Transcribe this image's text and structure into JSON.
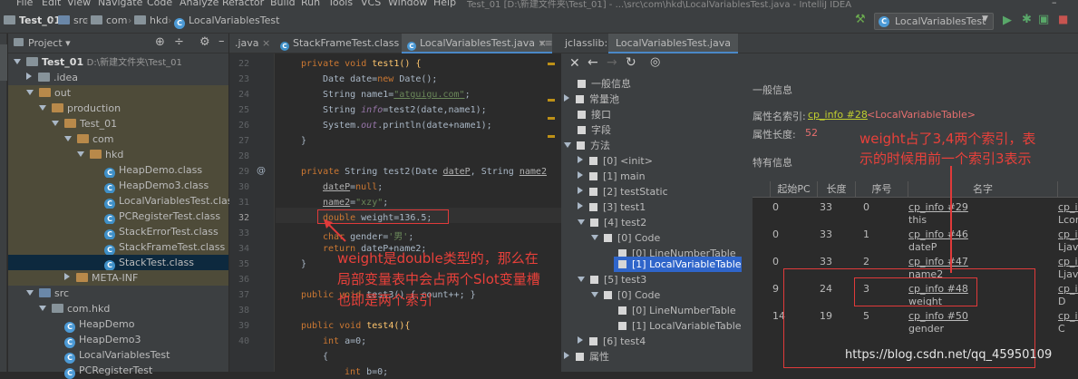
{
  "menu": [
    "File",
    "Edit",
    "View",
    "Navigate",
    "Code",
    "Analyze",
    "Refactor",
    "Build",
    "Run",
    "Tools",
    "VCS",
    "Window",
    "Help"
  ],
  "window_title": "Test_01 [D:\\新建文件夹\\Test_01] - ...\\src\\com\\hkd\\LocalVariablesTest.java - IntelliJ IDEA",
  "breadcrumb": [
    "Test_01",
    "src",
    "com",
    "hkd",
    "LocalVariablesTest"
  ],
  "run_config": "LocalVariablesTest",
  "project": {
    "title": "Project",
    "root_label": "Test_01",
    "root_path": "D:\\新建文件夹\\Test_01",
    "items": [
      ".idea",
      "out",
      "production",
      "Test_01",
      "com",
      "hkd",
      "HeapDemo.class",
      "HeapDemo3.class",
      "LocalVariablesTest.class",
      "PCRegisterTest.class",
      "StackErrorTest.class",
      "StackFrameTest.class",
      "StackTest.class",
      "META-INF",
      "src",
      "com.hkd",
      "HeapDemo",
      "HeapDemo3",
      "LocalVariablesTest",
      "PCRegisterTest"
    ]
  },
  "editor_tabs": [
    ".java",
    "StackFrameTest.class",
    "LocalVariablesTest.java"
  ],
  "line_numbers": [
    "22",
    "23",
    "24",
    "25",
    "26",
    "27",
    "28",
    "29",
    "30",
    "31",
    "32",
    "33",
    "34",
    "35",
    "36",
    "37",
    "38",
    "39",
    "40"
  ],
  "code": {
    "l22a": "private void ",
    "l22b": "test1() {",
    "l23a": "Date date=",
    "l23b": "new ",
    "l23c": "Date();",
    "l24a": "String name1=",
    "l24b": "\"atguigu.com\"",
    "l24c": ";",
    "l25a": "String ",
    "l25b": "info",
    "l25c": "=test2(date,name1);",
    "l26a": "System.",
    "l26b": "out",
    "l26c": ".println(date+name1);",
    "l27": "}",
    "l29a": "private ",
    "l29b": "String test2(Date ",
    "l29c": "dateP",
    ", ": ", ",
    "l29d": "String ",
    "l29e": "name2",
    "l30a": "dateP",
    "l30b": "=",
    "l30c": "null",
    ";": ";",
    "l31a": "name2",
    "l31b": "=",
    "l31c": "\"xzy\"",
    "l32a": "double ",
    "l32b": "weight=136.5;",
    "l33a": "char ",
    "l33b": "gender=",
    "l33c": "'男'",
    "l34a": "return ",
    "l34b": "dateP+name2;",
    "l35": "}",
    "l37a": "public void ",
    "l37b": "test3() { count++; }",
    "l39a": "public void ",
    "l39b": "test4(){",
    "l40a": "int ",
    "l40b": "a=0;",
    "l41": "{",
    "l42a": "int ",
    "l42b": "b=0;"
  },
  "jclasslib": {
    "label": "jclasslib:",
    "tab": "LocalVariablesTest.java",
    "tree": [
      "一般信息",
      "常量池",
      "接口",
      "字段",
      "方法",
      "[0] <init>",
      "[1] main",
      "[2] testStatic",
      "[3] test1",
      "[4] test2",
      "[0] Code",
      "[0] LineNumberTable",
      "[1] LocalVariableTable",
      "[5] test3",
      "[0] Code",
      "[0] LineNumberTable",
      "[1] LocalVariableTable",
      "[6] test4",
      "属性"
    ],
    "general_title": "一般信息",
    "attr_name_label": "属性名索引:",
    "attr_name_link": "cp_info #28",
    "attr_name_value": "<LocalVariableTable>",
    "attr_len_label": "属性长度:",
    "attr_len_value": "52",
    "specific_title": "特有信息",
    "columns": [
      "起始PC",
      "长度",
      "序号",
      "名字"
    ],
    "rows": [
      {
        "pc": "0",
        "len": "33",
        "idx": "0",
        "link": "cp_info #29",
        "name": "this",
        "desc": "Lcor"
      },
      {
        "pc": "0",
        "len": "33",
        "idx": "1",
        "link": "cp_info #46",
        "name": "dateP",
        "desc": "Ljav"
      },
      {
        "pc": "0",
        "len": "33",
        "idx": "2",
        "link": "cp_info #47",
        "name": "name2",
        "desc": "Ljav"
      },
      {
        "pc": "9",
        "len": "24",
        "idx": "3",
        "link": "cp_info #48",
        "name": "weight",
        "desc": "D"
      },
      {
        "pc": "14",
        "len": "19",
        "idx": "5",
        "link": "cp_info #50",
        "name": "gender",
        "desc": "C"
      }
    ],
    "desc_link": "cp_in"
  },
  "annotations": {
    "left_1": "weight是double类型的，那么在",
    "left_2": "局部变量表中会占两个Slot变量槽",
    "left_3": "也即是两个索引",
    "right_1": "weight占了3,4两个索引，表",
    "right_2": "示的时候用前一个索引3表示"
  },
  "watermark": "https://blog.csdn.net/qq_45950109"
}
